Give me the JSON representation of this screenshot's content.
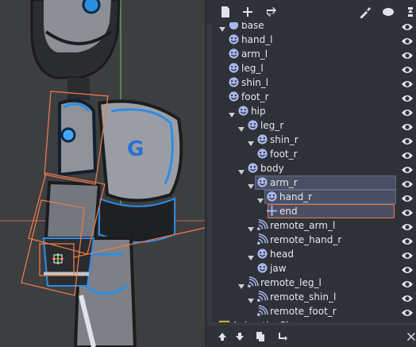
{
  "scene_tree": {
    "toolbar_icons": [
      "new-scene-icon",
      "add-node-icon",
      "instance-icon",
      "script-icon",
      "signals-icon",
      "groups-icon"
    ],
    "nodes": [
      {
        "label": "base",
        "depth": 0,
        "kind": "skeleton",
        "expanded": true
      },
      {
        "label": "hand_l",
        "depth": 1,
        "kind": "bone"
      },
      {
        "label": "arm_l",
        "depth": 1,
        "kind": "bone"
      },
      {
        "label": "leg_l",
        "depth": 1,
        "kind": "bone"
      },
      {
        "label": "shin_l",
        "depth": 1,
        "kind": "bone"
      },
      {
        "label": "foot_r",
        "depth": 1,
        "kind": "bone"
      },
      {
        "label": "hip",
        "depth": 1,
        "kind": "bone",
        "expanded": true
      },
      {
        "label": "leg_r",
        "depth": 2,
        "kind": "bone",
        "expanded": true
      },
      {
        "label": "shin_r",
        "depth": 3,
        "kind": "bone",
        "expanded": true
      },
      {
        "label": "foot_r",
        "depth": 4,
        "kind": "bone"
      },
      {
        "label": "body",
        "depth": 2,
        "kind": "bone",
        "expanded": true
      },
      {
        "label": "arm_r",
        "depth": 3,
        "kind": "bone",
        "expanded": true,
        "selected": true
      },
      {
        "label": "hand_r",
        "depth": 4,
        "kind": "bone",
        "expanded": true,
        "selected": true
      },
      {
        "label": "end",
        "depth": 5,
        "kind": "position",
        "selected": true,
        "highlighted": true
      },
      {
        "label": "remote_arm_l",
        "depth": 3,
        "kind": "remote",
        "expanded": true
      },
      {
        "label": "remote_hand_r",
        "depth": 4,
        "kind": "remote"
      },
      {
        "label": "head",
        "depth": 3,
        "kind": "bone",
        "expanded": true
      },
      {
        "label": "jaw",
        "depth": 4,
        "kind": "bone"
      },
      {
        "label": "remote_leg_l",
        "depth": 2,
        "kind": "remote",
        "expanded": true
      },
      {
        "label": "remote_shin_l",
        "depth": 3,
        "kind": "remote",
        "expanded": true
      },
      {
        "label": "remote_foot_r",
        "depth": 4,
        "kind": "remote"
      },
      {
        "label": "AnimationPlayer",
        "depth": 0,
        "kind": "animation"
      }
    ],
    "bottom_icons": [
      "move-up-icon",
      "move-down-icon",
      "duplicate-icon",
      "reparent-icon",
      "delete-icon"
    ]
  },
  "colors": {
    "accent": "#e87a4b",
    "bone_icon": "#a9b7ee",
    "selected_row": "#4b4f63"
  }
}
